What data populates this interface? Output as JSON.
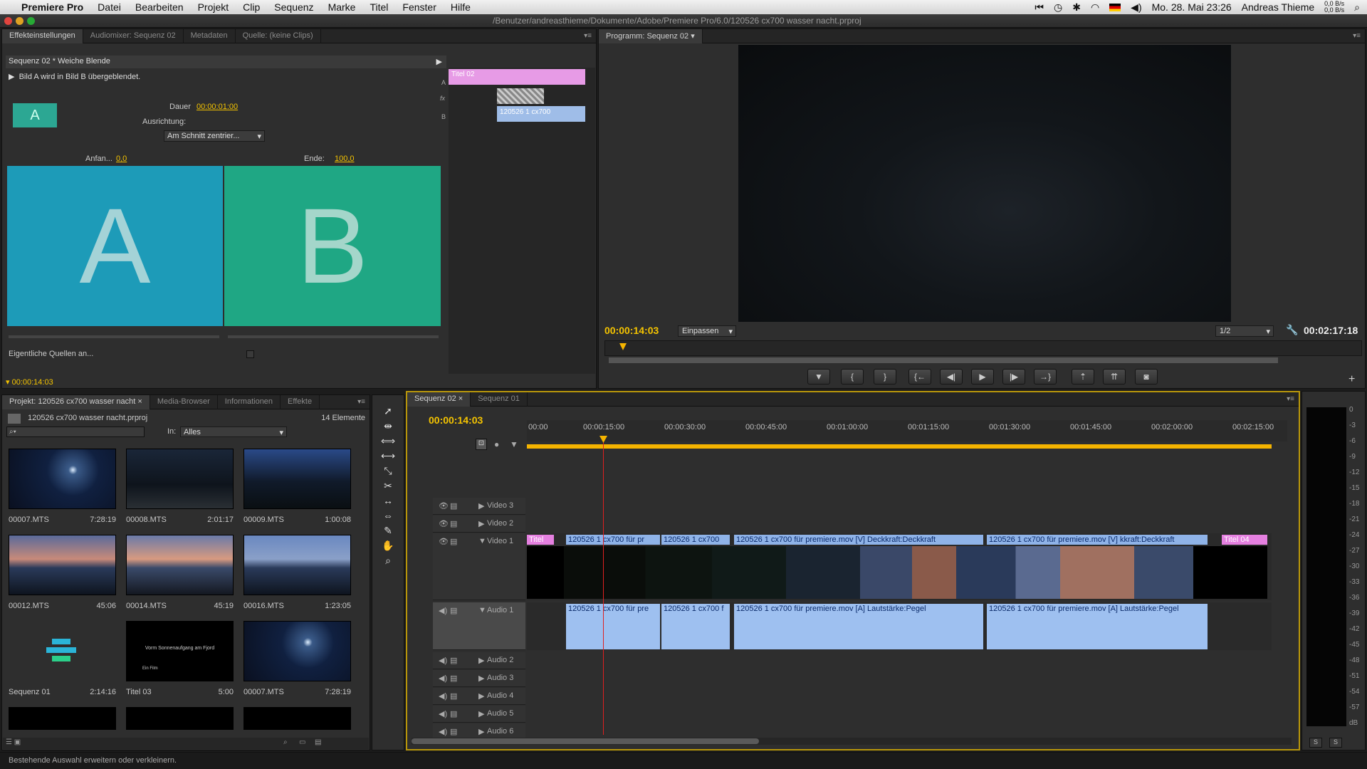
{
  "menubar": {
    "app_name": "Premiere Pro",
    "items": [
      "Datei",
      "Bearbeiten",
      "Projekt",
      "Clip",
      "Sequenz",
      "Marke",
      "Titel",
      "Fenster",
      "Hilfe"
    ],
    "clock": "Mo. 28. Mai 23:26",
    "user": "Andreas Thieme",
    "net_up": "0,0 B/s",
    "net_down": "0,0 B/s"
  },
  "window": {
    "title": "/Benutzer/andreasthieme/Dokumente/Adobe/Premiere Pro/6.0/120526 cx700 wasser nacht.prproj"
  },
  "effect_panel": {
    "tabs": [
      "Effekteinstellungen",
      "Audiomixer: Sequenz 02",
      "Metadaten",
      "Quelle: (keine Clips)"
    ],
    "header": "Sequenz 02 * Weiche Blende",
    "description": "Bild A wird in Bild B übergeblendet.",
    "duration_label": "Dauer",
    "duration_value": "00:00:01:00",
    "alignment_label": "Ausrichtung:",
    "alignment_value": "Am Schnitt zentrier...",
    "start_label": "Anfan...",
    "start_value": "0,0",
    "end_label": "Ende:",
    "end_value": "100,0",
    "tile_a": "A",
    "tile_b": "B",
    "icon_letter": "A",
    "show_sources_label": "Eigentliche Quellen an...",
    "mini_track_a": "A",
    "mini_track_fx": "fx",
    "mini_track_b": "B",
    "mini_clip_a": "Titel 02",
    "mini_clip_b": "120526 1 cx700",
    "timecode": "00:00:14:03"
  },
  "program_monitor": {
    "tab": "Programm: Sequenz 02",
    "timecode": "00:00:14:03",
    "fit": "Einpassen",
    "resolution": "1/2",
    "duration": "00:02:17:18",
    "buttons": [
      "marker",
      "in",
      "out",
      "goto-in",
      "step-back",
      "play",
      "step-forward",
      "goto-out",
      "lift",
      "extract",
      "export-frame"
    ]
  },
  "project_panel": {
    "tabs": [
      "Projekt: 120526 cx700 wasser nacht",
      "Media-Browser",
      "Informationen",
      "Effekte"
    ],
    "project_file": "120526 cx700 wasser nacht.prproj",
    "item_count": "14 Elemente",
    "in_label": "In:",
    "in_value": "Alles",
    "items": [
      {
        "name": "00007.MTS",
        "duration": "7:28:19"
      },
      {
        "name": "00008.MTS",
        "duration": "2:01:17"
      },
      {
        "name": "00009.MTS",
        "duration": "1:00:08"
      },
      {
        "name": "00012.MTS",
        "duration": "45:06"
      },
      {
        "name": "00014.MTS",
        "duration": "45:19"
      },
      {
        "name": "00016.MTS",
        "duration": "1:23:05"
      },
      {
        "name": "Sequenz 01",
        "duration": "2:14:16"
      },
      {
        "name": "Titel 03",
        "duration": "5:00"
      },
      {
        "name": "00007.MTS",
        "duration": "7:28:19"
      }
    ],
    "title03_text": "Vorm Sonnenaufgang am Fjord",
    "title03_sub": "Ein Film"
  },
  "timeline": {
    "tabs": [
      "Sequenz 02",
      "Sequenz 01"
    ],
    "timecode": "00:00:14:03",
    "ruler": [
      "00:00",
      "00:00:15:00",
      "00:00:30:00",
      "00:00:45:00",
      "00:01:00:00",
      "00:01:15:00",
      "00:01:30:00",
      "00:01:45:00",
      "00:02:00:00",
      "00:02:15:00"
    ],
    "video_tracks": [
      "Video 3",
      "Video 2",
      "Video 1"
    ],
    "audio_tracks": [
      "Audio 1",
      "Audio 2",
      "Audio 3",
      "Audio 4",
      "Audio 5",
      "Audio 6"
    ],
    "video_clips": [
      {
        "label": "Titel",
        "kind": "title"
      },
      {
        "label": "120526 1 cx700 für pr",
        "kind": "video"
      },
      {
        "label": "120526 1 cx700",
        "kind": "video"
      },
      {
        "label": "120526 1 cx700 für premiere.mov [V]  Deckkraft:Deckkraft",
        "kind": "video"
      },
      {
        "label": "120526 1 cx700 für premiere.mov [V]  kkraft:Deckkraft",
        "kind": "video"
      },
      {
        "label": "Titel 04",
        "kind": "title"
      }
    ],
    "audio_clips": [
      {
        "label": "120526 1 cx700 für pre"
      },
      {
        "label": "120526 1 cx700 f"
      },
      {
        "label": "120526 1 cx700 für premiere.mov [A]  Lautstärke:Pegel"
      },
      {
        "label": "120526 1 cx700 für premiere.mov [A]  Lautstärke:Pegel"
      }
    ]
  },
  "audio_meter": {
    "scale": [
      "0",
      "-3",
      "-6",
      "-9",
      "-12",
      "-15",
      "-18",
      "-21",
      "-24",
      "-27",
      "-30",
      "-33",
      "-36",
      "-39",
      "-42",
      "-45",
      "-48",
      "-51",
      "-54",
      "-57",
      "dB"
    ],
    "solo_left": "S",
    "solo_right": "S"
  },
  "status_bar": {
    "text": "Bestehende Auswahl erweitern oder verkleinern."
  },
  "colors": {
    "timecode": "#f5c400",
    "panel": "#2e2e2e",
    "transition_a": "#1d9bb8",
    "transition_b": "#1fa784",
    "video_clip": "#8fb3e8",
    "title_clip": "#e580e0",
    "playhead": "#e02020"
  }
}
